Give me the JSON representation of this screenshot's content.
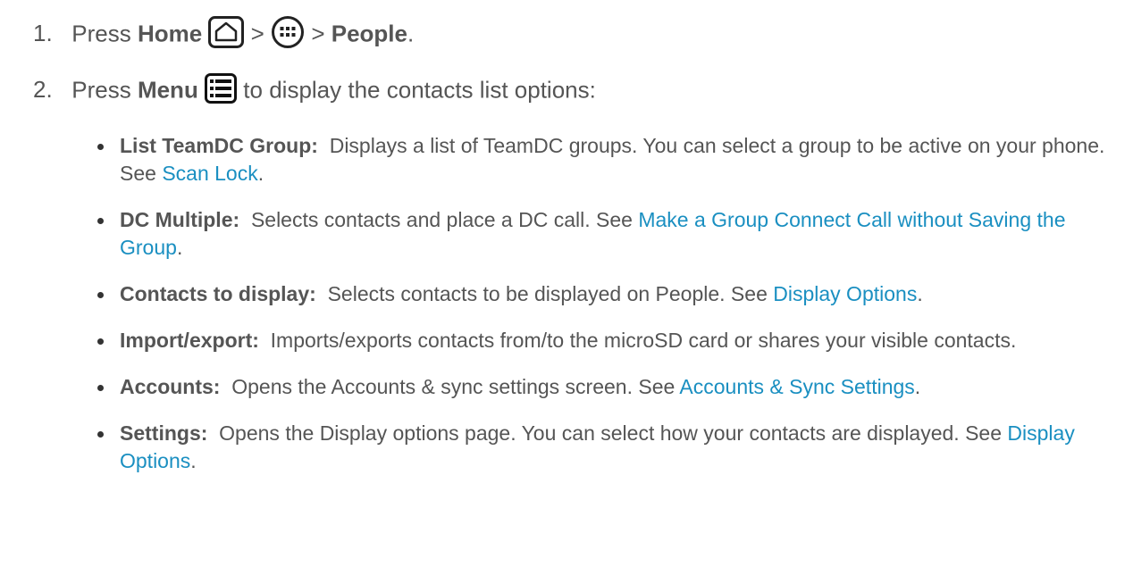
{
  "steps": [
    {
      "number": "1.",
      "prefix": "Press",
      "bold1": "Home",
      "sep1": ">",
      "sep2": ">",
      "bold2": "People",
      "suffix": "."
    },
    {
      "number": "2.",
      "prefix": "Press",
      "bold1": "Menu",
      "suffix": "to display the contacts list options:"
    }
  ],
  "icons": {
    "home": "home-icon",
    "apps": "apps-icon",
    "menu": "menu-icon"
  },
  "bullets": [
    {
      "term": "List TeamDC Group:",
      "text": "Displays a list of TeamDC groups. You can select a group to be active on your phone. See",
      "link": "Scan Lock",
      "end": "."
    },
    {
      "term": "DC Multiple:",
      "text": "Selects contacts and place a DC call. See",
      "link": "Make a Group Connect Call without Saving the Group",
      "end": "."
    },
    {
      "term": "Contacts to display:",
      "text": "Selects contacts to be displayed on People. See",
      "link": "Display Options",
      "end": "."
    },
    {
      "term": "Import/export:",
      "text": "Imports/exports contacts from/to the microSD card or shares your visible contacts.",
      "link": "",
      "end": ""
    },
    {
      "term": "Accounts:",
      "text": "Opens the Accounts & sync settings screen. See",
      "link": "Accounts & Sync Settings",
      "end": "."
    },
    {
      "term": "Settings:",
      "text": "Opens the Display options page. You can select how your contacts are displayed. See",
      "link": "Display Options",
      "end": "."
    }
  ],
  "colors": {
    "text": "#555555",
    "link": "#1a8fc1"
  }
}
